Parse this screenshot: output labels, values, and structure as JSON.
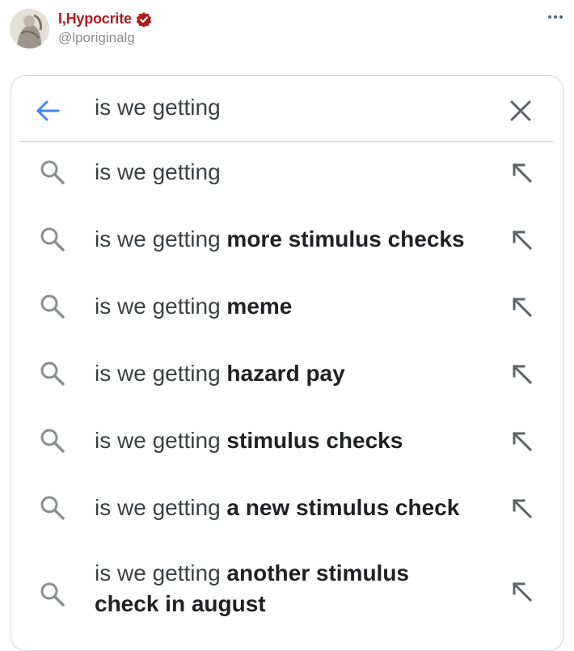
{
  "tweet": {
    "display_name": "I,Hypocrite",
    "handle": "@lporiginalg",
    "more_icon": "more-horizontal-icon",
    "verified_icon": "verified-badge-icon",
    "brand_color": "#b3181d"
  },
  "search": {
    "query": "is we getting",
    "back_icon": "arrow-left-icon",
    "clear_icon": "close-icon",
    "accent": "#4285f4"
  },
  "suggestions": [
    {
      "prefix": "is we getting",
      "completion": ""
    },
    {
      "prefix": "is we getting",
      "completion": "more stimulus checks"
    },
    {
      "prefix": "is we getting",
      "completion": "meme"
    },
    {
      "prefix": "is we getting",
      "completion": "hazard pay"
    },
    {
      "prefix": "is we getting",
      "completion": "stimulus checks"
    },
    {
      "prefix": "is we getting",
      "completion": "a new stimulus check"
    },
    {
      "prefix": "is we getting",
      "completion": "another stimulus",
      "completion_line2": "check in august"
    }
  ]
}
